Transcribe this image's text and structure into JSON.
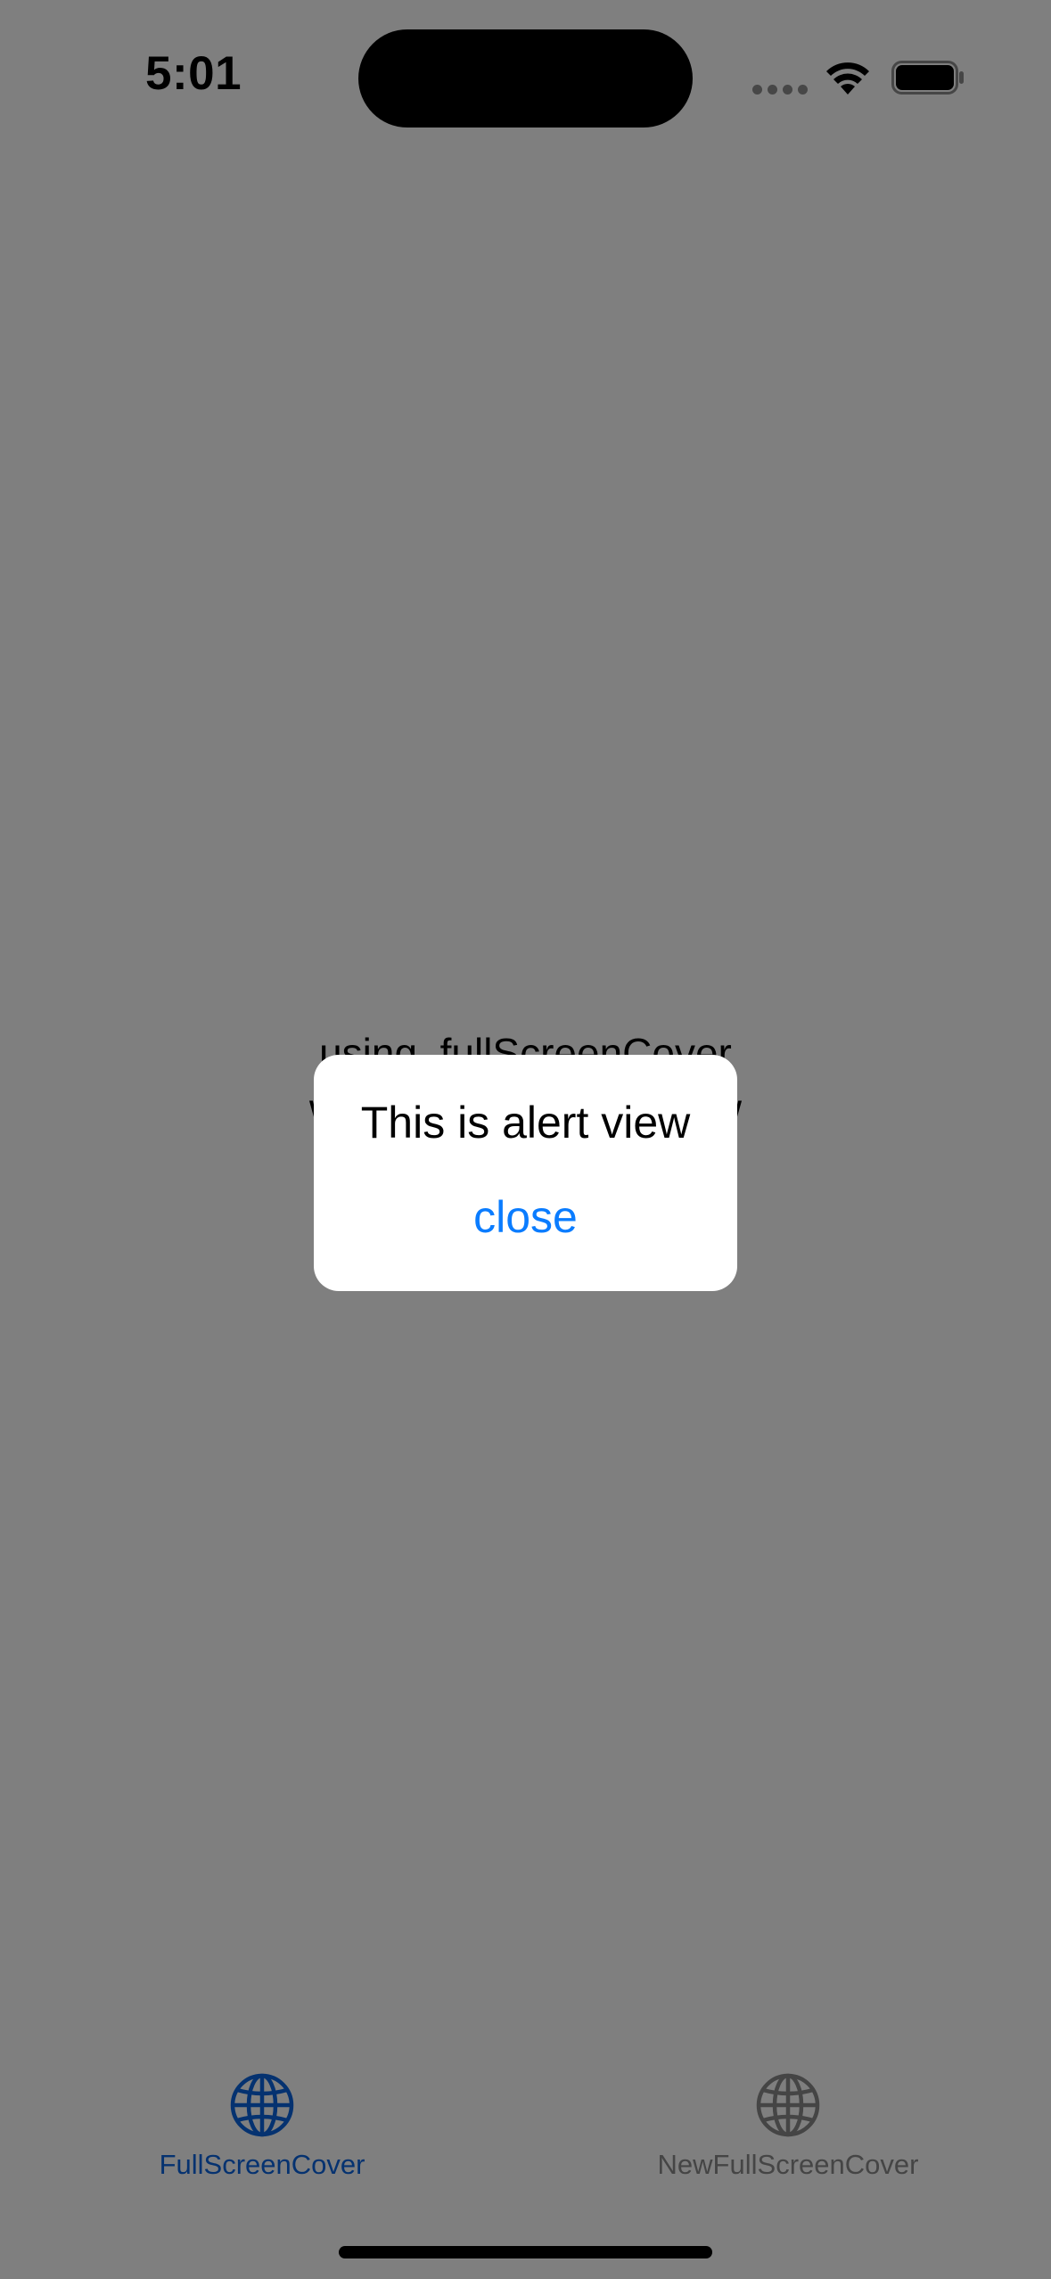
{
  "status_bar": {
    "time": "5:01",
    "signal_icon": "cellular-signal-icon",
    "wifi_icon": "wifi-icon",
    "battery_icon": "battery-icon"
  },
  "content": {
    "line1": "using .fullScreenCover",
    "line2": "with AlertContainerView"
  },
  "alert": {
    "title": "This is alert view",
    "close_label": "close"
  },
  "tabbar": {
    "tabs": [
      {
        "label": "FullScreenCover",
        "icon": "globe-icon",
        "selected": true
      },
      {
        "label": "NewFullScreenCover",
        "icon": "globe-icon",
        "selected": false
      }
    ]
  },
  "colors": {
    "accent": "#0a64e0",
    "alert_button": "#0a7cff",
    "dim_overlay": "rgba(0,0,0,0.5)",
    "inactive_tab": "#8a8a8a"
  }
}
